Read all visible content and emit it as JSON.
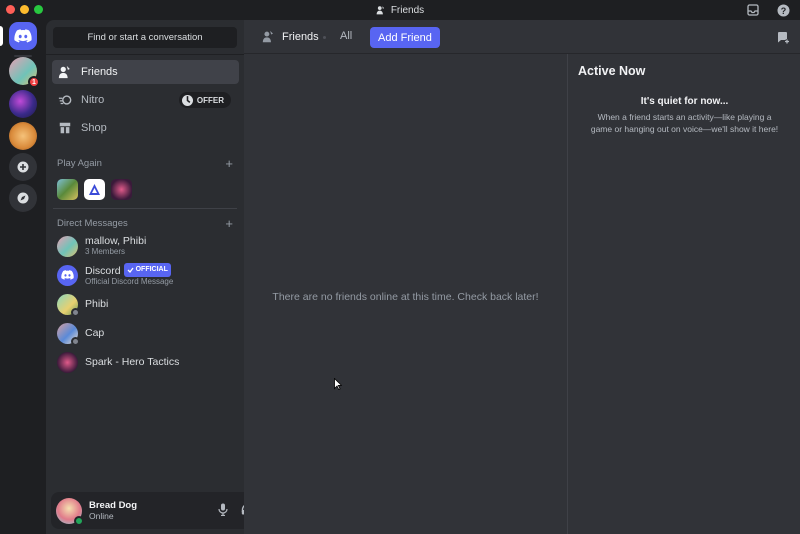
{
  "window": {
    "title": "Friends"
  },
  "colors": {
    "blurple": "#5865f2",
    "online": "#23a55a",
    "badge": "#f23f43"
  },
  "rail": {
    "badge_count": "1"
  },
  "sidebar": {
    "search_placeholder": "Find or start a conversation",
    "nav": [
      {
        "label": "Friends",
        "icon": "friends-icon"
      },
      {
        "label": "Nitro",
        "icon": "nitro-icon",
        "badge": "OFFER"
      },
      {
        "label": "Shop",
        "icon": "shop-icon"
      }
    ],
    "play_again": {
      "title": "Play Again",
      "add": "+"
    },
    "direct_messages": {
      "title": "Direct Messages",
      "add": "+",
      "items": [
        {
          "name": "mallow, Phibi",
          "sub": "3 Members"
        },
        {
          "name": "Discord",
          "tag": "OFFICIAL",
          "sub": "Official Discord Message"
        },
        {
          "name": "Phibi",
          "sub": ""
        },
        {
          "name": "Cap",
          "sub": ""
        },
        {
          "name": "Spark - Hero Tactics",
          "sub": ""
        }
      ]
    }
  },
  "user": {
    "name": "Bread Dog",
    "status": "Online"
  },
  "header": {
    "title": "Friends",
    "tab_all": "All",
    "add_friend": "Add Friend"
  },
  "main": {
    "empty": "There are no friends online at this time. Check back later!"
  },
  "active_now": {
    "title": "Active Now",
    "quiet": "It's quiet for now...",
    "desc": "When a friend starts an activity—like playing a game or hanging out on voice—we'll show it here!"
  }
}
